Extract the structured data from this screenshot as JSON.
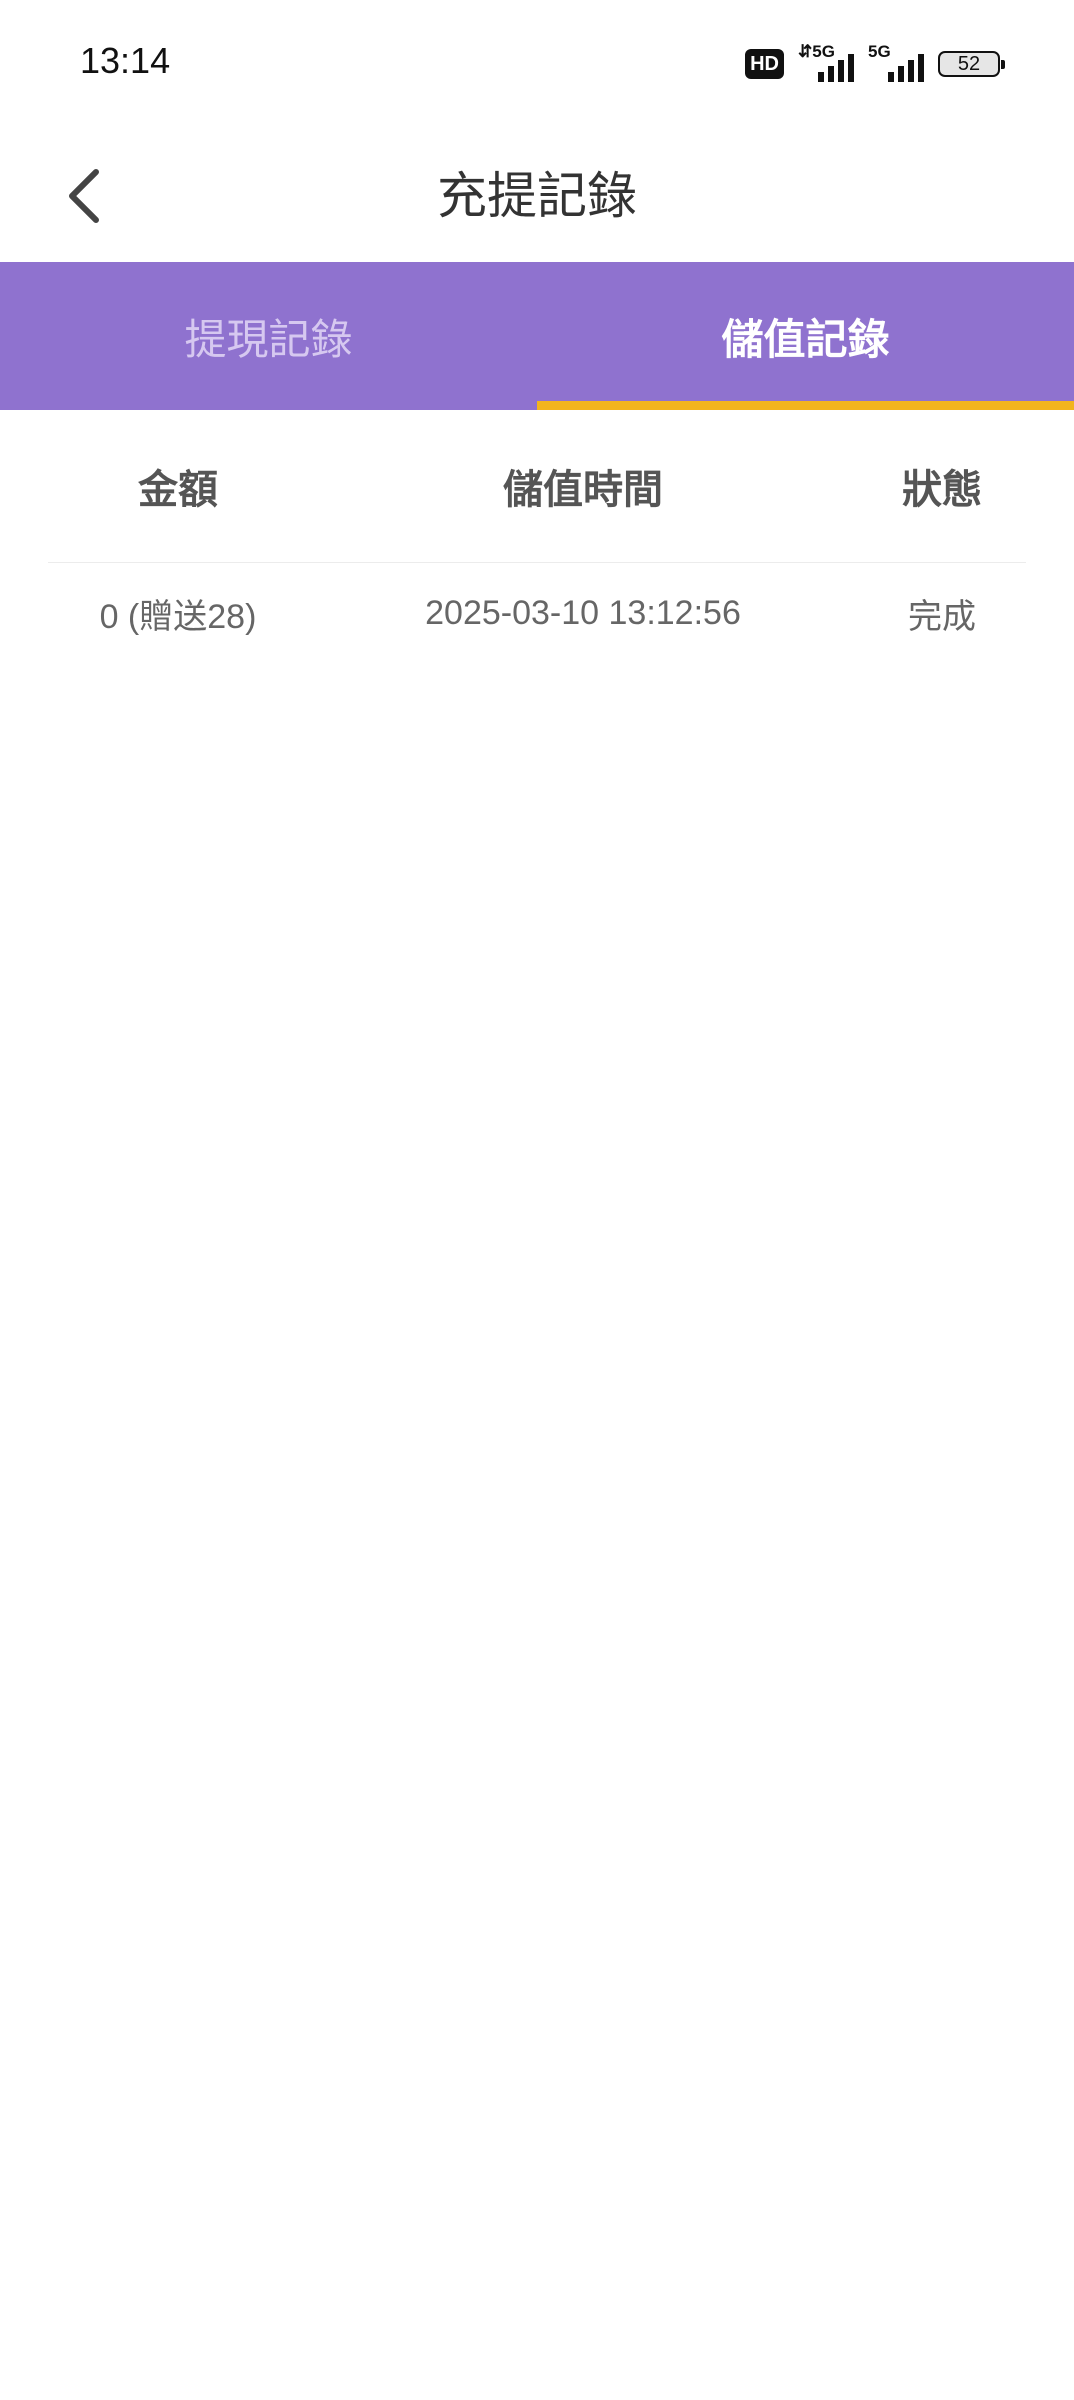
{
  "status_bar": {
    "time": "13:14",
    "hd_label": "HD",
    "signal_1_label": "⇵5G",
    "signal_2_label": "5G",
    "battery_level": "52"
  },
  "header": {
    "title": "充提記錄"
  },
  "tabs": [
    {
      "label": "提現記錄",
      "active": false
    },
    {
      "label": "儲值記錄",
      "active": true
    }
  ],
  "colors": {
    "tab_bar": "#8f72cf",
    "tab_indicator": "#f2b41e",
    "inactive_tab_text": "#d6c8f0"
  },
  "table": {
    "headers": [
      "金額",
      "儲值時間",
      "狀態"
    ],
    "rows": [
      [
        "0 (贈送28)",
        "2025-03-10 13:12:56",
        "完成"
      ]
    ]
  }
}
